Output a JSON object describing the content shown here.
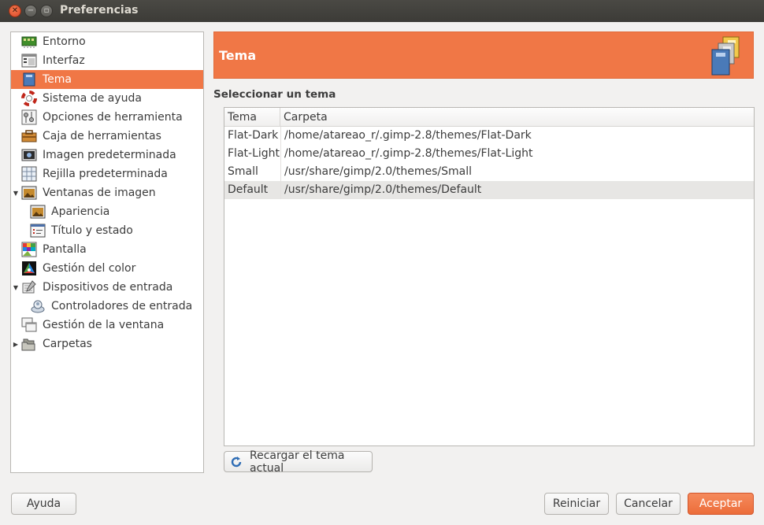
{
  "window": {
    "title": "Preferencias"
  },
  "nav": {
    "items": [
      {
        "label": "Entorno",
        "icon": "environment-icon"
      },
      {
        "label": "Interfaz",
        "icon": "interface-icon"
      },
      {
        "label": "Tema",
        "icon": "theme-icon",
        "selected": true
      },
      {
        "label": "Sistema de ayuda",
        "icon": "lifebuoy-icon"
      },
      {
        "label": "Opciones de herramienta",
        "icon": "tool-options-icon"
      },
      {
        "label": "Caja de herramientas",
        "icon": "toolbox-icon"
      },
      {
        "label": "Imagen predeterminada",
        "icon": "default-image-icon"
      },
      {
        "label": "Rejilla predeterminada",
        "icon": "grid-icon"
      },
      {
        "label": "Ventanas de imagen",
        "icon": "image-window-icon",
        "expanded": true
      },
      {
        "label": "Apariencia",
        "icon": "appearance-icon",
        "child": true
      },
      {
        "label": "Título y estado",
        "icon": "title-status-icon",
        "child": true
      },
      {
        "label": "Pantalla",
        "icon": "display-icon"
      },
      {
        "label": "Gestión del color",
        "icon": "color-management-icon"
      },
      {
        "label": "Dispositivos de entrada",
        "icon": "input-devices-icon",
        "expanded": true
      },
      {
        "label": "Controladores de entrada",
        "icon": "input-controllers-icon",
        "child": true
      },
      {
        "label": "Gestión de la ventana",
        "icon": "window-management-icon"
      },
      {
        "label": "Carpetas",
        "icon": "folders-icon",
        "collapsed": true
      }
    ]
  },
  "header": {
    "title": "Tema",
    "icon": "theme-stack-icon"
  },
  "section": {
    "label": "Seleccionar un tema"
  },
  "themes": {
    "columns": [
      "Tema",
      "Carpeta"
    ],
    "rows": [
      {
        "name": "Flat-Dark",
        "folder": "/home/atareao_r/.gimp-2.8/themes/Flat-Dark"
      },
      {
        "name": "Flat-Light",
        "folder": "/home/atareao_r/.gimp-2.8/themes/Flat-Light"
      },
      {
        "name": "Small",
        "folder": "/usr/share/gimp/2.0/themes/Small"
      },
      {
        "name": "Default",
        "folder": "/usr/share/gimp/2.0/themes/Default",
        "selected": true
      }
    ]
  },
  "buttons": {
    "reload": "Recargar el tema actual",
    "help": "Ayuda",
    "reset": "Reiniciar",
    "cancel": "Cancelar",
    "accept": "Aceptar"
  },
  "colors": {
    "accent": "#f07746",
    "titlebar": "#3c3b37"
  }
}
